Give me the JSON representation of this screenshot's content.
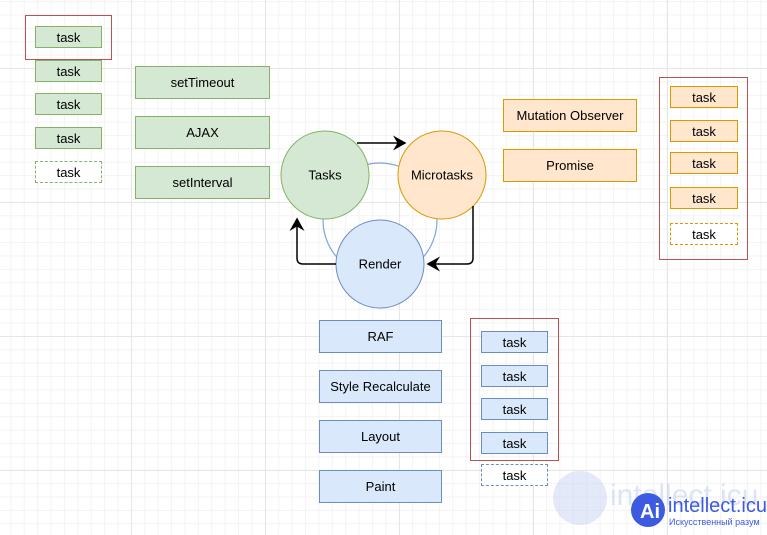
{
  "cycle": {
    "tasks": "Tasks",
    "microtasks": "Microtasks",
    "render": "Render"
  },
  "task_sources": [
    "setTimeout",
    "AJAX",
    "setInterval"
  ],
  "microtask_sources": [
    "Mutation Observer",
    "Promise"
  ],
  "render_steps": [
    "RAF",
    "Style Recalculate",
    "Layout",
    "Paint"
  ],
  "task_queue": [
    "task",
    "task",
    "task",
    "task",
    "task"
  ],
  "microtask_queue": [
    "task",
    "task",
    "task",
    "task",
    "task"
  ],
  "render_queue": [
    "task",
    "task",
    "task",
    "task",
    "task"
  ],
  "watermark": {
    "brand": "intellect.icu",
    "tagline": "Искусственный разум"
  },
  "colors": {
    "green": "#d5e8d4",
    "orange": "#ffe6cc",
    "blue": "#dae8fc",
    "red": "#b85450"
  }
}
